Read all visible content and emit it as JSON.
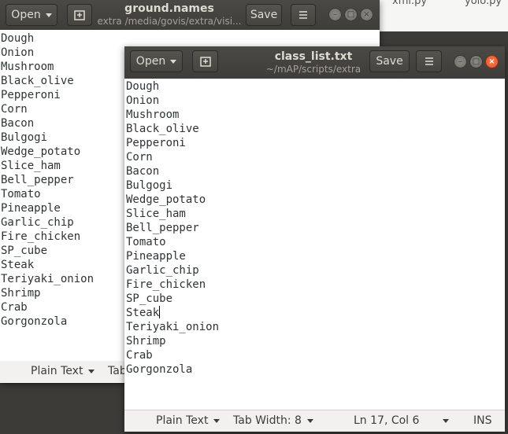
{
  "desktop": {
    "files": [
      "xml.py",
      "yolo.py"
    ]
  },
  "back_window": {
    "title": "ground.names",
    "subtitle": "extra /media/govis/extra/visi...",
    "open_label": "Open",
    "save_label": "Save",
    "lines": [
      "Dough",
      "Onion",
      "Mushroom",
      "Black_olive",
      "Pepperoni",
      "Corn",
      "Bacon",
      "Bulgogi",
      "Wedge_potato",
      "Slice_ham",
      "Bell_pepper",
      "Tomato",
      "Pineapple",
      "Garlic_chip",
      "Fire_chicken",
      "SP_cube",
      "Steak",
      "Teriyaki_onion",
      "Shrimp",
      "Crab",
      "Gorgonzola"
    ],
    "status": {
      "language": "Plain Text",
      "tab_width": "Tab"
    }
  },
  "front_window": {
    "title": "class_list.txt",
    "subtitle": "~/mAP/scripts/extra",
    "open_label": "Open",
    "save_label": "Save",
    "lines": [
      "Dough",
      "Onion",
      "Mushroom",
      "Black_olive",
      "Pepperoni",
      "Corn",
      "Bacon",
      "Bulgogi",
      "Wedge_potato",
      "Slice_ham",
      "Bell_pepper",
      "Tomato",
      "Pineapple",
      "Garlic_chip",
      "Fire_chicken",
      "SP_cube",
      "Steak",
      "Teriyaki_onion",
      "Shrimp",
      "Crab",
      "Gorgonzola"
    ],
    "cursor_line_index": 16,
    "status": {
      "language": "Plain Text",
      "tab_width": "Tab Width: 8",
      "position": "Ln 17, Col 6",
      "mode": "INS"
    }
  }
}
